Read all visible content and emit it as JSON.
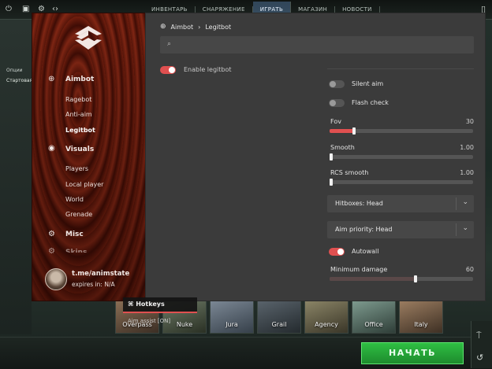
{
  "topbar": {
    "nav": [
      "ИНВЕНТАРЬ",
      "СНАРЯЖЕНИЕ",
      "ИГРАТЬ",
      "МАГАЗИН",
      "НОВОСТИ"
    ],
    "active_nav": "ИГРАТЬ",
    "icons": [
      "power-icon",
      "home-icon",
      "gear-icon",
      "code-icon",
      "settings-icon"
    ]
  },
  "left_side": {
    "text1": "Опции",
    "text2": "Стартовая игра"
  },
  "menu": {
    "categories": [
      {
        "label": "Aimbot",
        "icon": "crosshair-icon",
        "subs": [
          "Ragebot",
          "Anti-aim",
          "Legitbot"
        ]
      },
      {
        "label": "Visuals",
        "icon": "eye-icon",
        "subs": [
          "Players",
          "Local player",
          "World",
          "Grenade"
        ]
      },
      {
        "label": "Misc",
        "icon": "gear-icon",
        "subs": []
      }
    ],
    "active_sub": "Legitbot",
    "partial_category": "Skins",
    "profile": {
      "name": "t.me/animstate",
      "expires": "expires in: N/A"
    }
  },
  "panel": {
    "breadcrumb_root": "Aimbot",
    "breadcrumb_separator": "›",
    "breadcrumb_leaf": "Legitbot",
    "search_placeholder": "",
    "enable_label": "Enable legitbot",
    "enable_on": true,
    "silent_aim_label": "Silent aim",
    "silent_aim_on": false,
    "flash_check_label": "Flash check",
    "flash_check_on": false,
    "fov_label": "Fov",
    "fov_value": "30",
    "fov_fraction": 0.17,
    "smooth_label": "Smooth",
    "smooth_value": "1.00",
    "smooth_fraction": 0.0,
    "rcs_label": "RCS smooth",
    "rcs_value": "1.00",
    "rcs_fraction": 0.0,
    "hitboxes_label": "Hitboxes: Head",
    "aim_priority_label": "Aim priority: Head",
    "autowall_label": "Autowall",
    "autowall_on": true,
    "min_damage_label": "Minimum damage",
    "min_damage_value": "60",
    "min_damage_fraction": 0.6
  },
  "hotkeys": {
    "title": "Hotkeys",
    "item": "Aim assist  [ON]"
  },
  "maps": [
    "Overpass",
    "Nuke",
    "Jura",
    "Grail",
    "Agency",
    "Office",
    "Italy"
  ],
  "start_label": "НАЧАТЬ"
}
